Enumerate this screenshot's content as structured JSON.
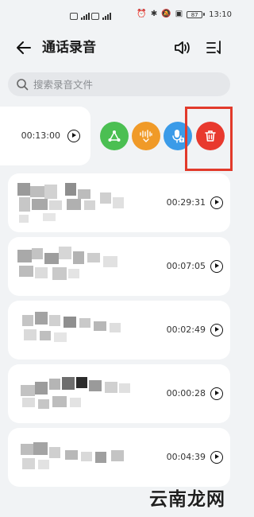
{
  "status_bar": {
    "time": "13:10",
    "battery": "87"
  },
  "header": {
    "title": "通话录音"
  },
  "search": {
    "placeholder": "搜索录音文件"
  },
  "swiped_item": {
    "duration": "00:13:00",
    "actions": [
      "share-icon",
      "tag-icon",
      "voice-to-text-icon",
      "delete-icon"
    ]
  },
  "recordings": [
    {
      "duration": "00:29:31"
    },
    {
      "duration": "00:07:05"
    },
    {
      "duration": "00:02:49"
    },
    {
      "duration": "00:00:28"
    },
    {
      "duration": "00:04:39"
    }
  ],
  "colors": {
    "share": "#4bbf52",
    "tag": "#f09a28",
    "voice": "#3b9be8",
    "delete": "#e8392e",
    "highlight": "#e23a2b"
  },
  "watermark": "云南龙网"
}
